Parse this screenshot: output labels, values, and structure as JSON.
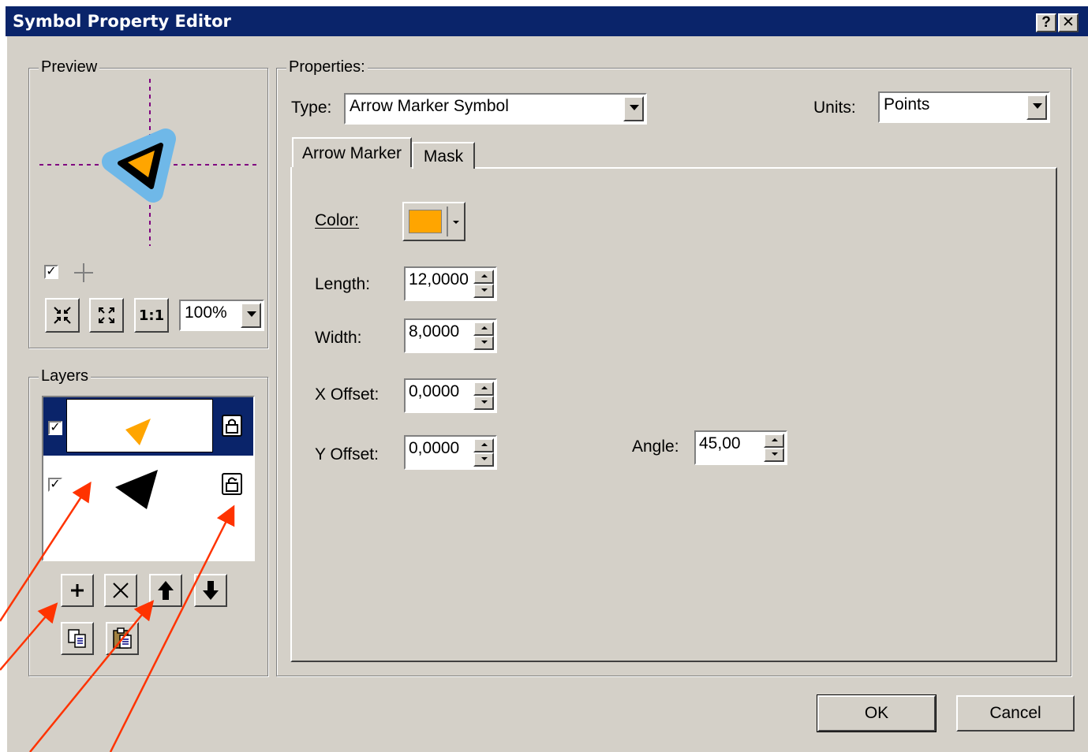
{
  "window": {
    "title": "Symbol Property Editor",
    "help_glyph": "?",
    "close_glyph": "✕"
  },
  "preview": {
    "group_label": "Preview",
    "zoom_value": "100%",
    "fixed_zoom_label": "1:1"
  },
  "layers": {
    "group_label": "Layers",
    "items": [
      {
        "checked": true,
        "selected": true,
        "color": "#ffa500",
        "lock": "locked"
      },
      {
        "checked": true,
        "selected": false,
        "color": "#000000",
        "lock": "unlocked"
      }
    ]
  },
  "properties": {
    "group_label": "Properties:",
    "type_label": "Type:",
    "type_value": "Arrow Marker Symbol",
    "units_label": "Units:",
    "units_value": "Points",
    "tabs": [
      {
        "label": "Arrow Marker",
        "active": true
      },
      {
        "label": "Mask",
        "active": false
      }
    ],
    "color_label": "Color:",
    "color_value": "#ffa500",
    "length_label": "Length:",
    "length_value": "12,0000",
    "width_label": "Width:",
    "width_value": "8,0000",
    "xoffset_label": "X Offset:",
    "xoffset_value": "0,0000",
    "yoffset_label": "Y Offset:",
    "yoffset_value": "0,0000",
    "angle_label": "Angle:",
    "angle_value": "45,00"
  },
  "buttons": {
    "ok_label": "OK",
    "cancel_label": "Cancel"
  },
  "colors": {
    "dialog_bg": "#d4d0c8",
    "title_bg": "#0a246a",
    "selection": "#0a246a",
    "annotation_arrow": "#ff3300",
    "preview_guides": "#800080",
    "preview_halo": "#87cefa"
  }
}
